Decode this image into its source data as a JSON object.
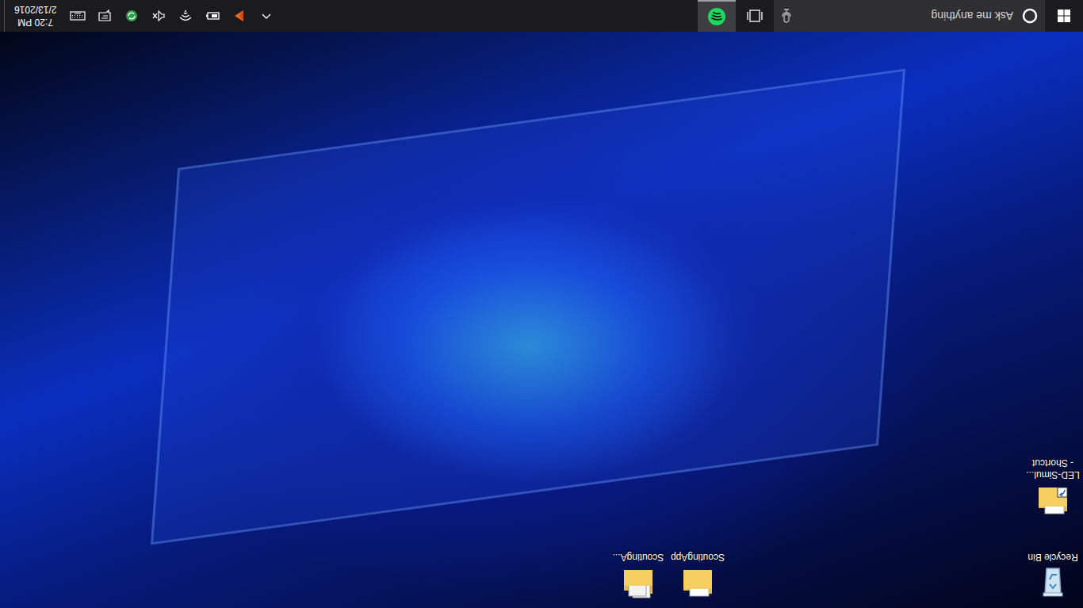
{
  "desktop_icons": [
    {
      "lines": [
        "Recycle Bin"
      ],
      "kind": "recycle-bin"
    },
    {
      "lines": [
        "LED-Simul...",
        "- Shortcut"
      ],
      "kind": "folder-shortcut"
    },
    {
      "lines": [
        "ScoutingApp"
      ],
      "kind": "folder"
    },
    {
      "lines": [
        "ScoutingA..."
      ],
      "kind": "documents-folder"
    }
  ],
  "taskbar": {
    "search": {
      "placeholder": "Ask me anything"
    },
    "apps": [
      {
        "selected": true
      }
    ],
    "clock": {
      "time": "7:20 PM",
      "date": "2/13/2016"
    }
  }
}
